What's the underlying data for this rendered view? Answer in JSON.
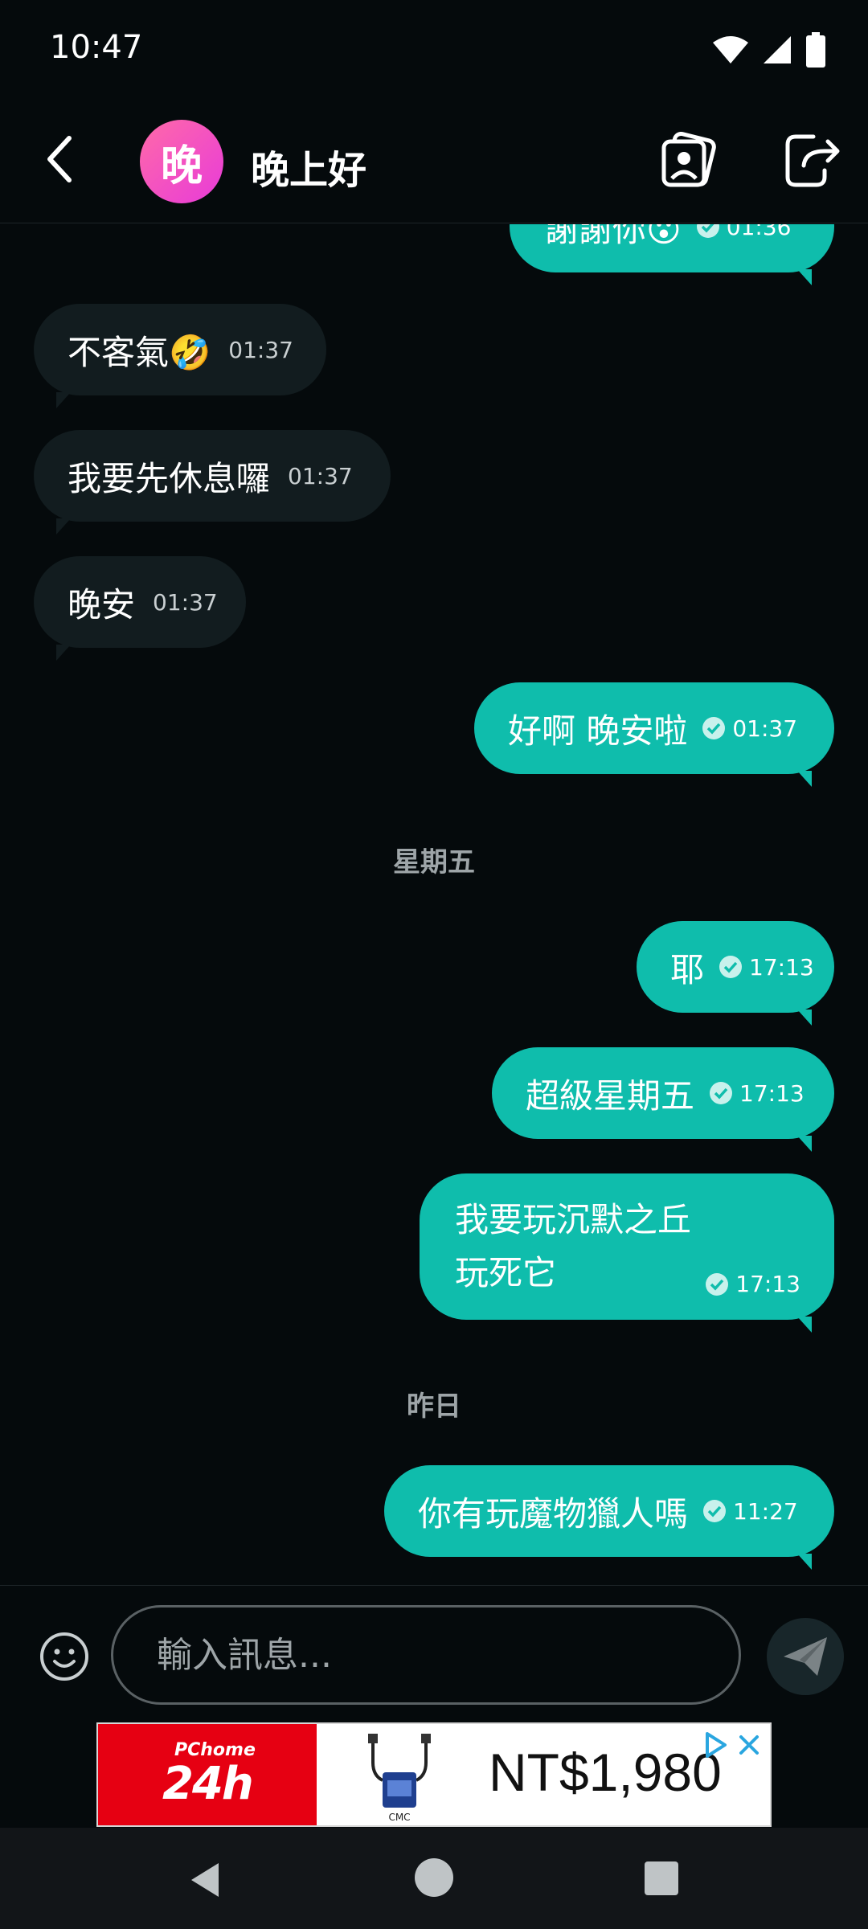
{
  "status_bar": {
    "time": "10:47"
  },
  "header": {
    "avatar_letter": "晚",
    "title": "晚上好"
  },
  "messages": [
    {
      "direction": "outgoing",
      "text": "謝謝你😮",
      "time": "01:36"
    },
    {
      "direction": "incoming",
      "text": "不客氣🤣",
      "time": "01:37"
    },
    {
      "direction": "incoming",
      "text": "我要先休息囉",
      "time": "01:37"
    },
    {
      "direction": "incoming",
      "text": "晚安",
      "time": "01:37"
    },
    {
      "direction": "outgoing",
      "text": "好啊 晚安啦",
      "time": "01:37"
    },
    {
      "direction": "outgoing",
      "text": "耶",
      "time": "17:13"
    },
    {
      "direction": "outgoing",
      "text": "超級星期五",
      "time": "17:13"
    },
    {
      "direction": "outgoing",
      "text_line1": "我要玩沉默之丘",
      "text_line2": "玩死它",
      "time": "17:13"
    },
    {
      "direction": "outgoing",
      "text": "你有玩魔物獵人嗎",
      "time": "11:27"
    }
  ],
  "date_separators": [
    "星期五",
    "昨日"
  ],
  "composer": {
    "placeholder": "輸入訊息..."
  },
  "ad": {
    "brand_small": "PChome",
    "brand_big": "24h",
    "product_brand": "CMC",
    "price": "NT$1,980"
  },
  "colors": {
    "outgoing_bubble": "#0fbdac",
    "incoming_bubble": "#121c1f",
    "background": "#050a0c"
  },
  "icons": [
    "back-arrow-icon",
    "photo-gallery-icon",
    "share-exit-icon",
    "emoji-icon",
    "send-icon",
    "ad-choices-icon",
    "ad-close-icon"
  ]
}
